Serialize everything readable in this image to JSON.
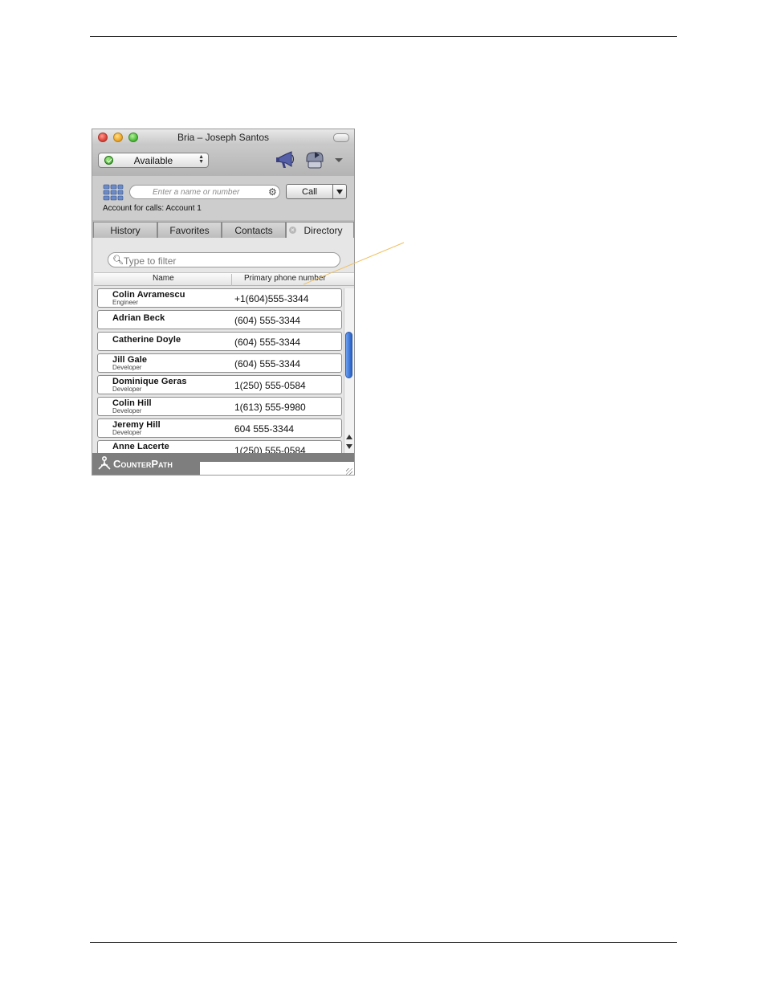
{
  "window": {
    "title": "Bria – Joseph Santos"
  },
  "status": {
    "label": "Available"
  },
  "dialer": {
    "placeholder": "Enter a name or number",
    "call_label": "Call",
    "account_line": "Account for calls: Account 1"
  },
  "tabs": [
    {
      "label": "History"
    },
    {
      "label": "Favorites"
    },
    {
      "label": "Contacts"
    },
    {
      "label": "Directory"
    }
  ],
  "directory": {
    "filter_placeholder": "Type to filter",
    "columns": [
      "Name",
      "Primary phone number"
    ],
    "rows": [
      {
        "name": "Colin Avramescu",
        "title": "Engineer",
        "phone": "+1(604)555-3344"
      },
      {
        "name": "Adrian Beck",
        "title": "",
        "phone": "(604) 555-3344"
      },
      {
        "name": "Catherine Doyle",
        "title": "",
        "phone": "(604) 555-3344"
      },
      {
        "name": "Jill Gale",
        "title": "Developer",
        "phone": "(604) 555-3344"
      },
      {
        "name": "Dominique Geras",
        "title": "Developer",
        "phone": "1(250) 555-0584"
      },
      {
        "name": "Colin Hill",
        "title": "Developer",
        "phone": "1(613) 555-9980"
      },
      {
        "name": "Jeremy Hill",
        "title": "Developer",
        "phone": "604 555-3344"
      },
      {
        "name": "Anne Lacerte",
        "title": "",
        "phone": "1(250) 555-0584"
      }
    ]
  },
  "footer": {
    "brand": "CounterPath"
  },
  "colors": {
    "accent_blue": "#3f78d8",
    "status_green": "#2f9a1e",
    "callout_line": "#f0c060"
  }
}
